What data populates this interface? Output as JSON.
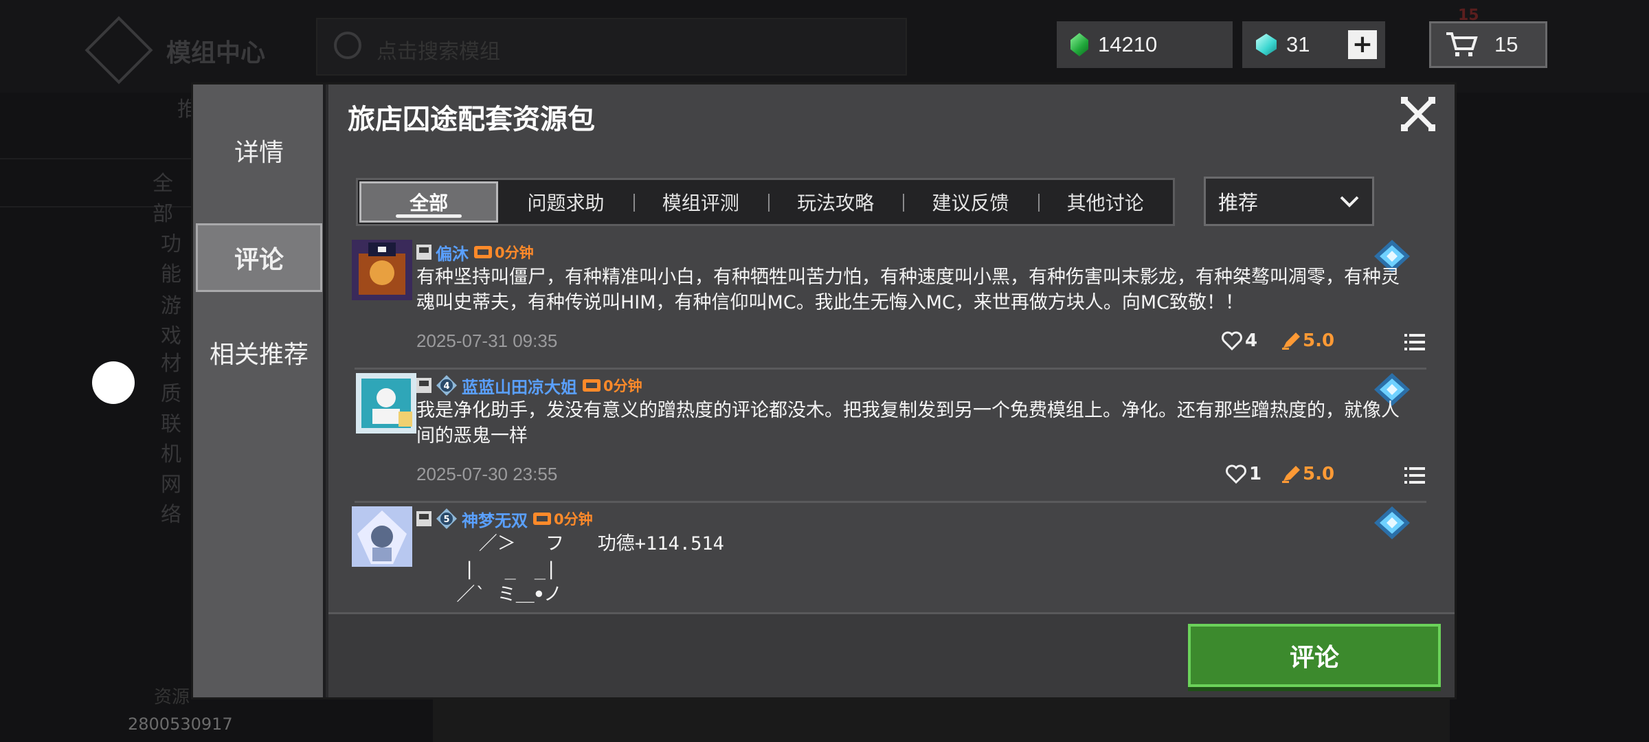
{
  "background": {
    "title": "模组中心",
    "search_placeholder": "点击搜索模组",
    "side_items": [
      "推",
      "全部",
      "功能",
      "游戏",
      "材质",
      "联机",
      "网络"
    ],
    "bottom_label": "资源",
    "user_id": "2800530917",
    "cart_badge": "15"
  },
  "currency": {
    "emerald": "14210",
    "diamond": "31",
    "cart_count": "15",
    "emerald_color": "#2ecc55",
    "diamond_color": "#3ad6d0"
  },
  "modal": {
    "title": "旅店囚途配套资源包",
    "side_tabs": [
      "详情",
      "评论",
      "相关推荐"
    ],
    "active_side_tab": "评论",
    "filter_tabs": [
      "全部",
      "问题求助",
      "模组评测",
      "玩法攻略",
      "建议反馈",
      "其他讨论"
    ],
    "active_filter_tab": "全部",
    "sort_label": "推荐",
    "comment_button": "评论"
  },
  "comments": [
    {
      "username": "偏沐",
      "level": "",
      "play_time": "0分钟",
      "text": "有种坚持叫僵尸，有种精准叫小白，有种牺牲叫苦力怕，有种速度叫小黑，有种伤害叫末影龙，有种桀骜叫凋零，有种灵魂叫史蒂夫，有种传说叫HIM，有种信仰叫MC。我此生无悔入MC，来世再做方块人。向MC致敬！！",
      "time": "2025-07-31 09:35",
      "likes": "4",
      "rating": "5.0"
    },
    {
      "username": "蓝蓝山田凉大姐",
      "level": "4",
      "play_time": "0分钟",
      "text": "我是净化助手，发没有意义的蹭热度的评论都没木。把我复制发到另一个免费模组上。净化。还有那些蹭热度的，就像人间的恶鬼一样",
      "time": "2025-07-30 23:55",
      "likes": "1",
      "rating": "5.0"
    },
    {
      "username": "神梦无双",
      "level": "5",
      "play_time": "0分钟",
      "ascii": "   ／＞　 フ   功德+114.514\n　| 　_　_|\n ／` ミ＿ꔷノ"
    }
  ]
}
